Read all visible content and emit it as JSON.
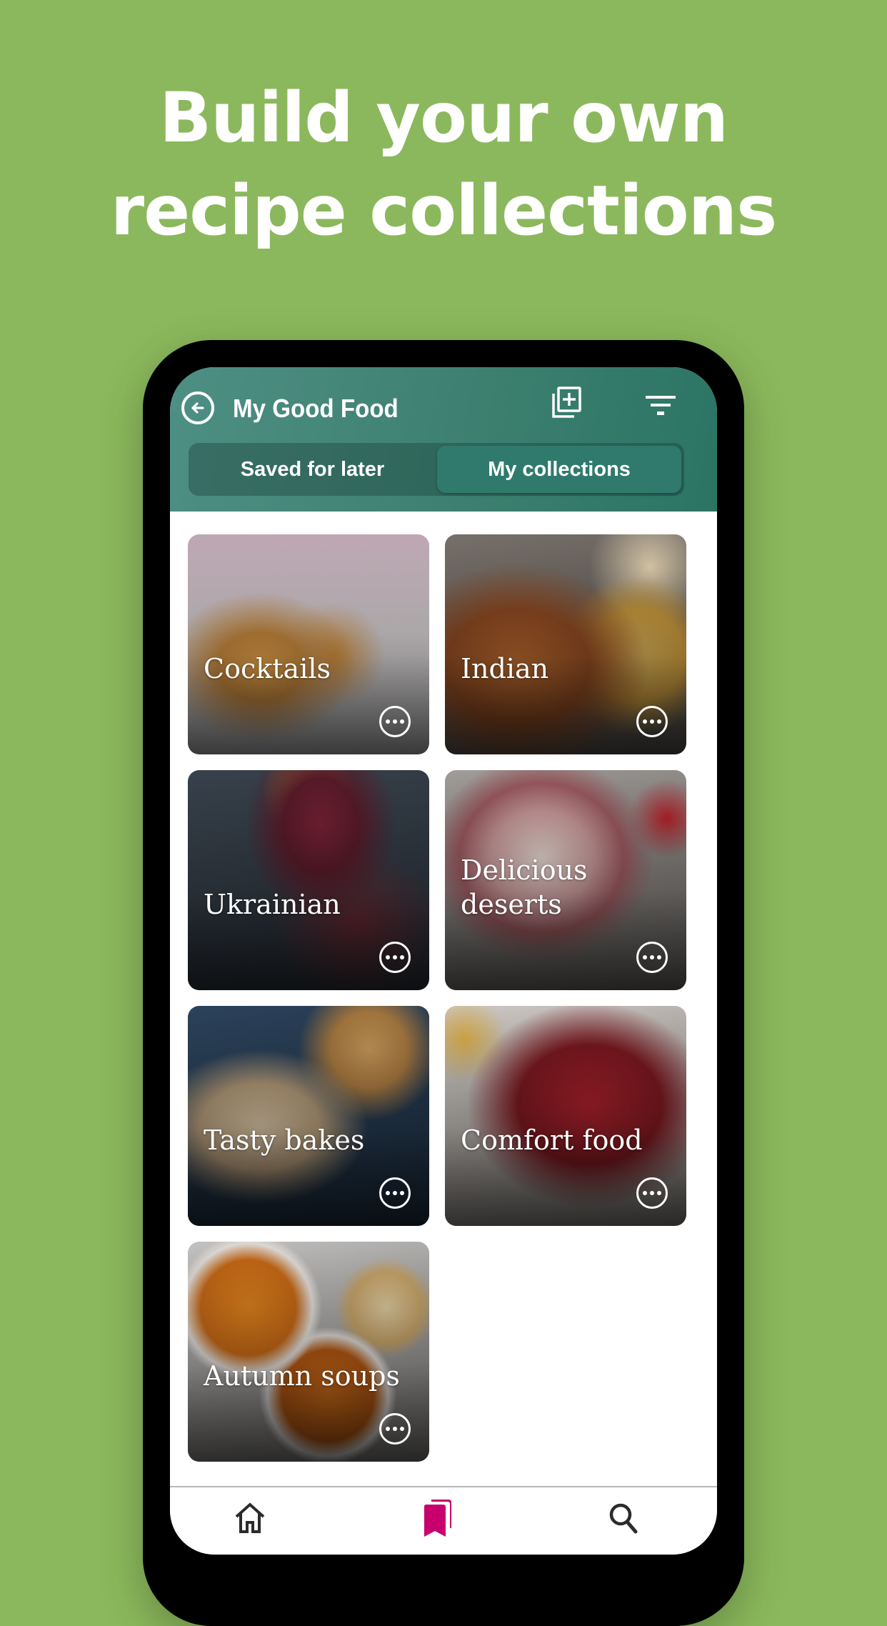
{
  "headline": {
    "line1": "Build your own",
    "line2": "recipe collections"
  },
  "colors": {
    "background": "#8bb85c",
    "appbar": "#3d8070",
    "active_tab": "#2f7a6c",
    "nav_active": "#c8006e",
    "nav_inactive": "#2b2b2b"
  },
  "appbar": {
    "back_icon": "back-arrow-circle-icon",
    "title": "My Good Food",
    "actions": [
      {
        "icon": "add-collection-icon",
        "label": "Add collection"
      },
      {
        "icon": "filter-icon",
        "label": "Filter"
      }
    ]
  },
  "tabs": [
    {
      "label": "Saved for later",
      "active": false
    },
    {
      "label": "My collections",
      "active": true
    }
  ],
  "collections": [
    {
      "title": "Cocktails",
      "theme": "cocktails"
    },
    {
      "title": "Indian",
      "theme": "indian"
    },
    {
      "title": "Ukrainian",
      "theme": "ukrainian"
    },
    {
      "title": "Delicious deserts",
      "theme": "deserts"
    },
    {
      "title": "Tasty bakes",
      "theme": "bakes"
    },
    {
      "title": "Comfort food",
      "theme": "comfort"
    },
    {
      "title": "Autumn soups",
      "theme": "soups"
    }
  ],
  "more_icon": "more-options-icon",
  "bottom_nav": [
    {
      "icon": "home-icon",
      "label": "Home",
      "active": false
    },
    {
      "icon": "saved-collections-icon",
      "label": "Saved",
      "active": true
    },
    {
      "icon": "search-icon",
      "label": "Search",
      "active": false
    }
  ]
}
